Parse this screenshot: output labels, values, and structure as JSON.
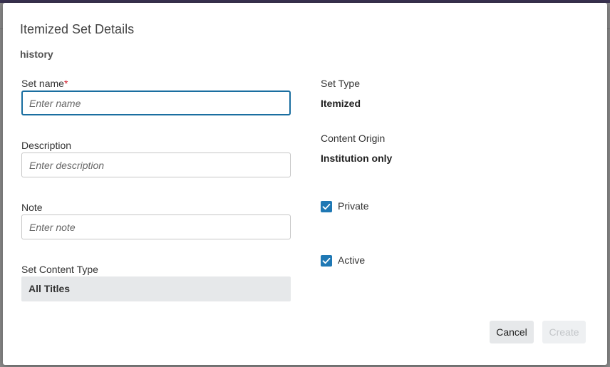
{
  "modal": {
    "title": "Itemized Set Details",
    "subtitle": "history"
  },
  "form": {
    "set_name": {
      "label": "Set name",
      "required_mark": "*",
      "placeholder": "Enter name",
      "value": ""
    },
    "description": {
      "label": "Description",
      "placeholder": "Enter description",
      "value": ""
    },
    "note": {
      "label": "Note",
      "placeholder": "Enter note",
      "value": ""
    },
    "content_type": {
      "label": "Set Content Type",
      "selected": "All Titles"
    }
  },
  "details": {
    "set_type": {
      "label": "Set Type",
      "value": "Itemized"
    },
    "content_origin": {
      "label": "Content Origin",
      "value": "Institution only"
    },
    "private": {
      "label": "Private",
      "checked": true
    },
    "active": {
      "label": "Active",
      "checked": true
    }
  },
  "actions": {
    "cancel_label": "Cancel",
    "create_label": "Create"
  },
  "colors": {
    "accent": "#1f78b4",
    "focus_border": "#1a6ea0",
    "required": "#d11a2a"
  }
}
